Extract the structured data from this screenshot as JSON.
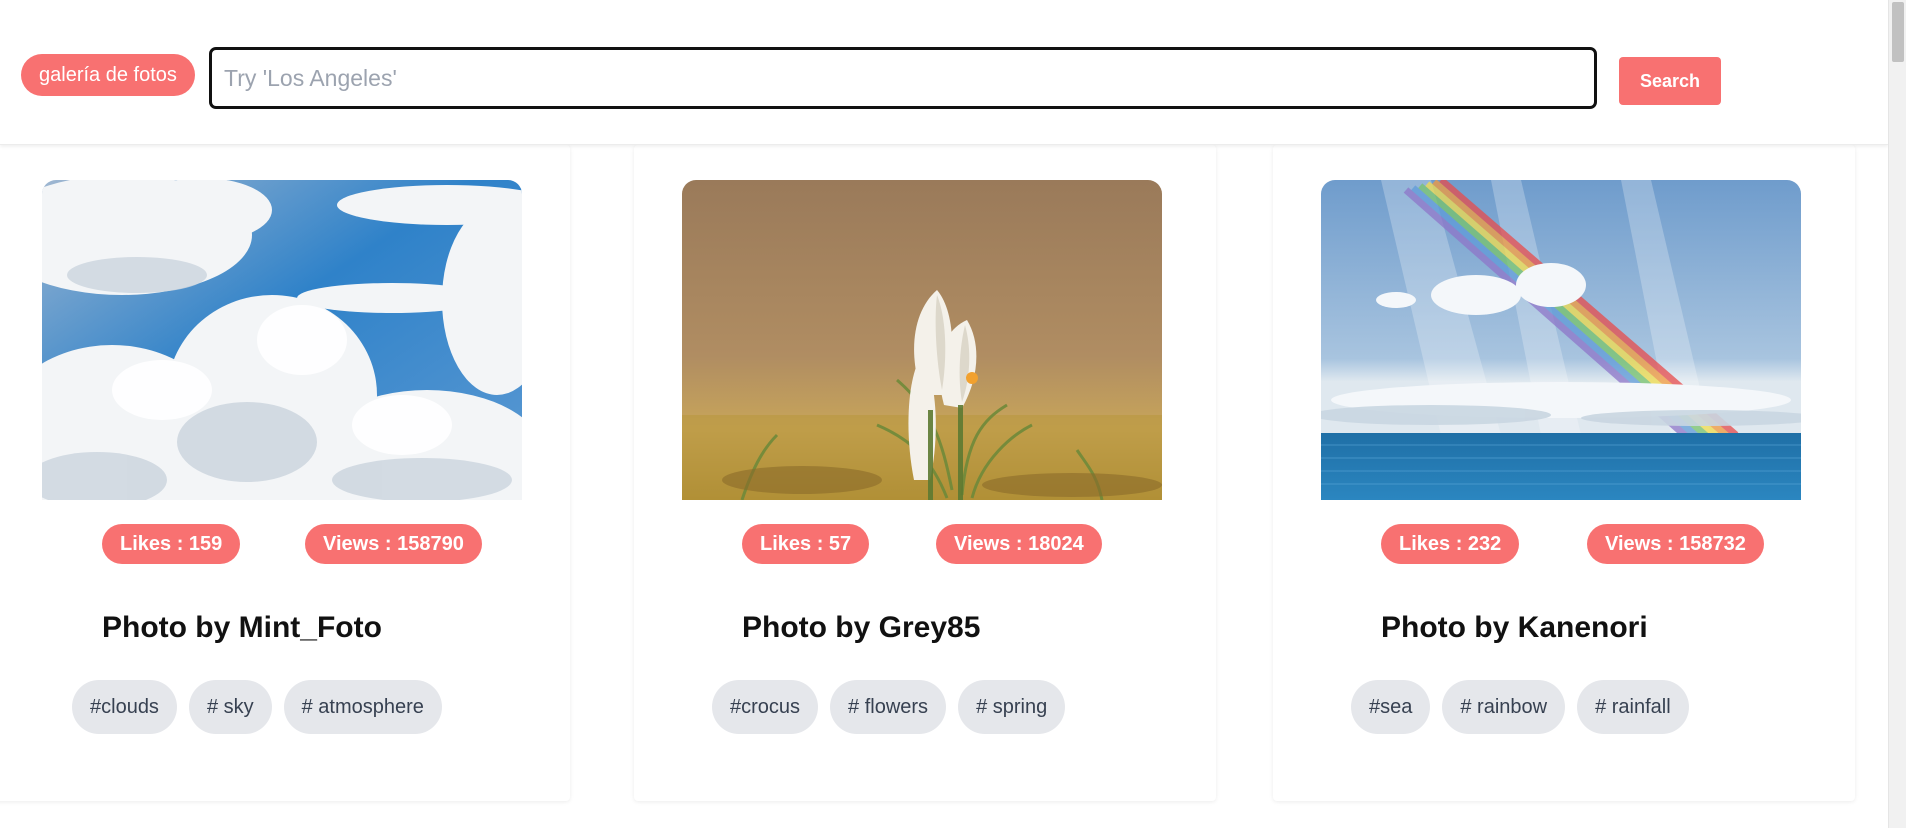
{
  "header": {
    "brand": "galería de fotos",
    "search_placeholder": "Try 'Los Angeles'",
    "search_value": "",
    "search_button": "Search"
  },
  "colors": {
    "accent": "#f87171",
    "tag_background": "#e5e7eb",
    "tag_text": "#374151"
  },
  "cards": [
    {
      "image_subject": "clouds in blue sky",
      "likes": "Likes : 159",
      "views": "Views : 158790",
      "title": "Photo by Mint_Foto",
      "tags": [
        "#clouds",
        "# sky",
        "# atmosphere"
      ]
    },
    {
      "image_subject": "white crocus flowers",
      "likes": "Likes : 57",
      "views": "Views : 18024",
      "title": "Photo by Grey85",
      "tags": [
        "#crocus",
        "# flowers",
        "# spring"
      ]
    },
    {
      "image_subject": "rainbow over sea",
      "likes": "Likes : 232",
      "views": "Views : 158732",
      "title": "Photo by Kanenori",
      "tags": [
        "#sea",
        "# rainbow",
        "# rainfall"
      ]
    }
  ]
}
